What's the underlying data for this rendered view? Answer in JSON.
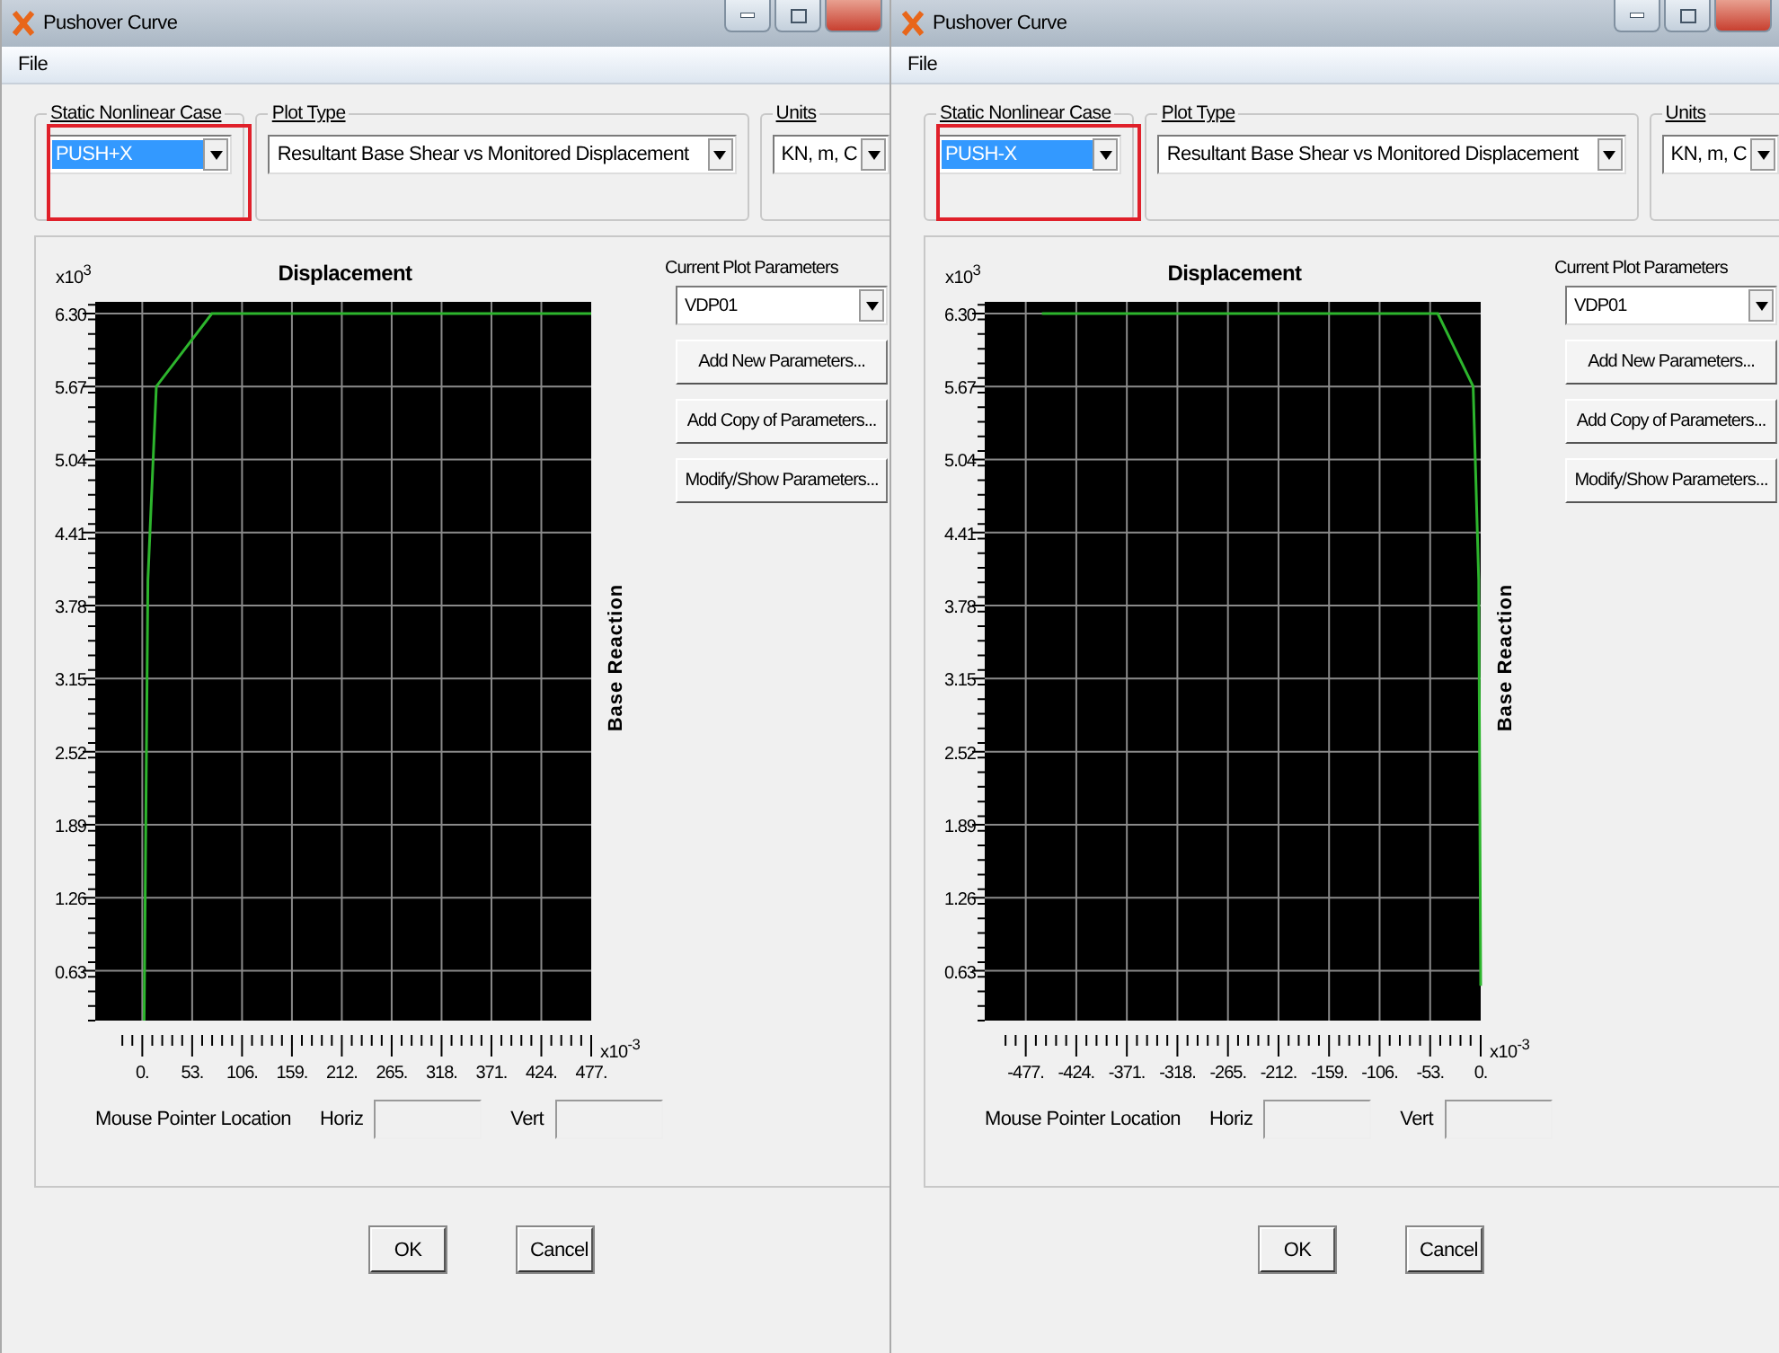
{
  "windows": [
    {
      "title": "Pushover Curve",
      "menu": [
        "File"
      ],
      "case_group": {
        "label": "Static Nonlinear Case",
        "value": "PUSH+X",
        "value_selected": true,
        "highlighted": true
      },
      "plot_type": {
        "label": "Plot Type",
        "value": "Resultant Base Shear vs Monitored Displacement"
      },
      "units": {
        "label": "Units",
        "value": "KN, m, C"
      },
      "chart": {
        "y_scale": "x10$^{3}$",
        "x_scale": "x10$^{-3}$",
        "chart_data": {
          "type": "line",
          "grid": true,
          "title": "Displacement",
          "ylabel": "Base Reaction",
          "xlim": [
            -50,
            477
          ],
          "ylim": [
            0.2,
            6.4
          ],
          "xticks": [
            {
              "value": 0,
              "label": "0."
            },
            {
              "value": 53,
              "label": "53."
            },
            {
              "value": 106,
              "label": "106."
            },
            {
              "value": 159,
              "label": "159."
            },
            {
              "value": 212,
              "label": "212."
            },
            {
              "value": 265,
              "label": "265."
            },
            {
              "value": 318,
              "label": "318."
            },
            {
              "value": 371,
              "label": "371."
            },
            {
              "value": 424,
              "label": "424."
            },
            {
              "value": 477,
              "label": "477."
            }
          ],
          "yticks": [
            {
              "value": 0.63,
              "label": "0.63"
            },
            {
              "value": 1.26,
              "label": "1.26"
            },
            {
              "value": 1.89,
              "label": "1.89"
            },
            {
              "value": 2.52,
              "label": "2.52"
            },
            {
              "value": 3.15,
              "label": "3.15"
            },
            {
              "value": 3.78,
              "label": "3.78"
            },
            {
              "value": 4.41,
              "label": "4.41"
            },
            {
              "value": 5.04,
              "label": "5.04"
            },
            {
              "value": 5.67,
              "label": "5.67"
            },
            {
              "value": 6.3,
              "label": "6.30"
            }
          ],
          "x": [
            2,
            6,
            15,
            74,
            477
          ],
          "series": [
            {
              "color": "#2db52d",
              "values": [
                0.2,
                4.0,
                5.67,
                6.3,
                6.3
              ]
            }
          ]
        }
      },
      "params": {
        "label": "Current Plot Parameters",
        "value": "VDP01",
        "buttons": [
          "Add New Parameters...",
          "Add Copy of Parameters...",
          "Modify/Show Parameters..."
        ]
      },
      "pointer": {
        "label": "Mouse Pointer Location",
        "horiz": "Horiz",
        "vert": "Vert"
      },
      "buttons": [
        "OK",
        "Cancel"
      ]
    },
    {
      "title": "Pushover Curve",
      "menu": [
        "File"
      ],
      "case_group": {
        "label": "Static Nonlinear Case",
        "value": "PUSH-X",
        "value_selected": true,
        "highlighted": true
      },
      "plot_type": {
        "label": "Plot Type",
        "value": "Resultant Base Shear vs Monitored Displacement"
      },
      "units": {
        "label": "Units",
        "value": "KN, m, C"
      },
      "chart": {
        "y_scale": "x10$^{3}$",
        "x_scale": "x10$^{-3}$",
        "chart_data": {
          "type": "line",
          "grid": true,
          "title": "Displacement",
          "ylabel": "Base Reaction",
          "xlim": [
            -520,
            0
          ],
          "ylim": [
            0.2,
            6.4
          ],
          "xticks": [
            {
              "value": -477,
              "label": "-477."
            },
            {
              "value": -424,
              "label": "-424."
            },
            {
              "value": -371,
              "label": "-371."
            },
            {
              "value": -318,
              "label": "-318."
            },
            {
              "value": -265,
              "label": "-265."
            },
            {
              "value": -212,
              "label": "-212."
            },
            {
              "value": -159,
              "label": "-159."
            },
            {
              "value": -106,
              "label": "-106."
            },
            {
              "value": -53,
              "label": "-53."
            },
            {
              "value": 0,
              "label": "0."
            }
          ],
          "yticks": [
            {
              "value": 0.63,
              "label": "0.63"
            },
            {
              "value": 1.26,
              "label": "1.26"
            },
            {
              "value": 1.89,
              "label": "1.89"
            },
            {
              "value": 2.52,
              "label": "2.52"
            },
            {
              "value": 3.15,
              "label": "3.15"
            },
            {
              "value": 3.78,
              "label": "3.78"
            },
            {
              "value": 4.41,
              "label": "4.41"
            },
            {
              "value": 5.04,
              "label": "5.04"
            },
            {
              "value": 5.67,
              "label": "5.67"
            },
            {
              "value": 6.3,
              "label": "6.30"
            }
          ],
          "x": [
            0,
            -2,
            -8,
            -45,
            -460
          ],
          "series": [
            {
              "color": "#2db52d",
              "values": [
                0.5,
                4.0,
                5.67,
                6.3,
                6.3
              ]
            }
          ]
        }
      },
      "params": {
        "label": "Current Plot Parameters",
        "value": "VDP01",
        "buttons": [
          "Add New Parameters...",
          "Add Copy of Parameters...",
          "Modify/Show Parameters..."
        ]
      },
      "pointer": {
        "label": "Mouse Pointer Location",
        "horiz": "Horiz",
        "vert": "Vert"
      },
      "buttons": [
        "OK",
        "Cancel"
      ]
    }
  ]
}
